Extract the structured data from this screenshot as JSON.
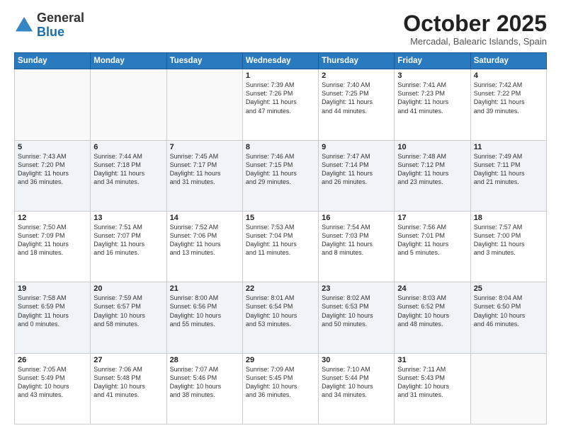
{
  "header": {
    "logo_general": "General",
    "logo_blue": "Blue",
    "month_title": "October 2025",
    "location": "Mercadal, Balearic Islands, Spain"
  },
  "days_of_week": [
    "Sunday",
    "Monday",
    "Tuesday",
    "Wednesday",
    "Thursday",
    "Friday",
    "Saturday"
  ],
  "weeks": [
    [
      {
        "day": "",
        "content": ""
      },
      {
        "day": "",
        "content": ""
      },
      {
        "day": "",
        "content": ""
      },
      {
        "day": "1",
        "content": "Sunrise: 7:39 AM\nSunset: 7:26 PM\nDaylight: 11 hours\nand 47 minutes."
      },
      {
        "day": "2",
        "content": "Sunrise: 7:40 AM\nSunset: 7:25 PM\nDaylight: 11 hours\nand 44 minutes."
      },
      {
        "day": "3",
        "content": "Sunrise: 7:41 AM\nSunset: 7:23 PM\nDaylight: 11 hours\nand 41 minutes."
      },
      {
        "day": "4",
        "content": "Sunrise: 7:42 AM\nSunset: 7:22 PM\nDaylight: 11 hours\nand 39 minutes."
      }
    ],
    [
      {
        "day": "5",
        "content": "Sunrise: 7:43 AM\nSunset: 7:20 PM\nDaylight: 11 hours\nand 36 minutes."
      },
      {
        "day": "6",
        "content": "Sunrise: 7:44 AM\nSunset: 7:18 PM\nDaylight: 11 hours\nand 34 minutes."
      },
      {
        "day": "7",
        "content": "Sunrise: 7:45 AM\nSunset: 7:17 PM\nDaylight: 11 hours\nand 31 minutes."
      },
      {
        "day": "8",
        "content": "Sunrise: 7:46 AM\nSunset: 7:15 PM\nDaylight: 11 hours\nand 29 minutes."
      },
      {
        "day": "9",
        "content": "Sunrise: 7:47 AM\nSunset: 7:14 PM\nDaylight: 11 hours\nand 26 minutes."
      },
      {
        "day": "10",
        "content": "Sunrise: 7:48 AM\nSunset: 7:12 PM\nDaylight: 11 hours\nand 23 minutes."
      },
      {
        "day": "11",
        "content": "Sunrise: 7:49 AM\nSunset: 7:11 PM\nDaylight: 11 hours\nand 21 minutes."
      }
    ],
    [
      {
        "day": "12",
        "content": "Sunrise: 7:50 AM\nSunset: 7:09 PM\nDaylight: 11 hours\nand 18 minutes."
      },
      {
        "day": "13",
        "content": "Sunrise: 7:51 AM\nSunset: 7:07 PM\nDaylight: 11 hours\nand 16 minutes."
      },
      {
        "day": "14",
        "content": "Sunrise: 7:52 AM\nSunset: 7:06 PM\nDaylight: 11 hours\nand 13 minutes."
      },
      {
        "day": "15",
        "content": "Sunrise: 7:53 AM\nSunset: 7:04 PM\nDaylight: 11 hours\nand 11 minutes."
      },
      {
        "day": "16",
        "content": "Sunrise: 7:54 AM\nSunset: 7:03 PM\nDaylight: 11 hours\nand 8 minutes."
      },
      {
        "day": "17",
        "content": "Sunrise: 7:56 AM\nSunset: 7:01 PM\nDaylight: 11 hours\nand 5 minutes."
      },
      {
        "day": "18",
        "content": "Sunrise: 7:57 AM\nSunset: 7:00 PM\nDaylight: 11 hours\nand 3 minutes."
      }
    ],
    [
      {
        "day": "19",
        "content": "Sunrise: 7:58 AM\nSunset: 6:59 PM\nDaylight: 11 hours\nand 0 minutes."
      },
      {
        "day": "20",
        "content": "Sunrise: 7:59 AM\nSunset: 6:57 PM\nDaylight: 10 hours\nand 58 minutes."
      },
      {
        "day": "21",
        "content": "Sunrise: 8:00 AM\nSunset: 6:56 PM\nDaylight: 10 hours\nand 55 minutes."
      },
      {
        "day": "22",
        "content": "Sunrise: 8:01 AM\nSunset: 6:54 PM\nDaylight: 10 hours\nand 53 minutes."
      },
      {
        "day": "23",
        "content": "Sunrise: 8:02 AM\nSunset: 6:53 PM\nDaylight: 10 hours\nand 50 minutes."
      },
      {
        "day": "24",
        "content": "Sunrise: 8:03 AM\nSunset: 6:52 PM\nDaylight: 10 hours\nand 48 minutes."
      },
      {
        "day": "25",
        "content": "Sunrise: 8:04 AM\nSunset: 6:50 PM\nDaylight: 10 hours\nand 46 minutes."
      }
    ],
    [
      {
        "day": "26",
        "content": "Sunrise: 7:05 AM\nSunset: 5:49 PM\nDaylight: 10 hours\nand 43 minutes."
      },
      {
        "day": "27",
        "content": "Sunrise: 7:06 AM\nSunset: 5:48 PM\nDaylight: 10 hours\nand 41 minutes."
      },
      {
        "day": "28",
        "content": "Sunrise: 7:07 AM\nSunset: 5:46 PM\nDaylight: 10 hours\nand 38 minutes."
      },
      {
        "day": "29",
        "content": "Sunrise: 7:09 AM\nSunset: 5:45 PM\nDaylight: 10 hours\nand 36 minutes."
      },
      {
        "day": "30",
        "content": "Sunrise: 7:10 AM\nSunset: 5:44 PM\nDaylight: 10 hours\nand 34 minutes."
      },
      {
        "day": "31",
        "content": "Sunrise: 7:11 AM\nSunset: 5:43 PM\nDaylight: 10 hours\nand 31 minutes."
      },
      {
        "day": "",
        "content": ""
      }
    ]
  ]
}
